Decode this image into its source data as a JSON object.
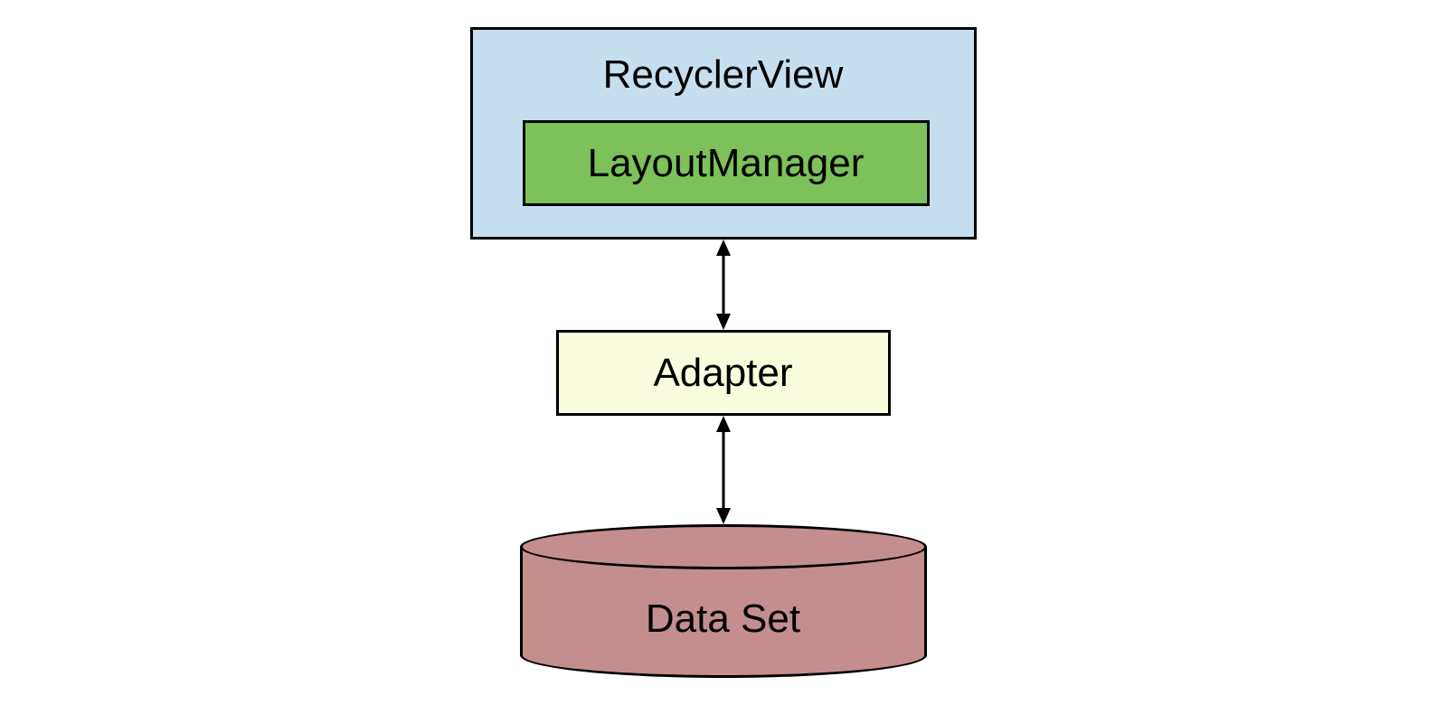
{
  "boxes": {
    "recyclerview": "RecyclerView",
    "layoutmanager": "LayoutManager",
    "adapter": "Adapter",
    "dataset": "Data Set"
  },
  "colors": {
    "recyclerview_bg": "#c6dff0",
    "layoutmanager_bg": "#7cc15a",
    "adapter_bg": "#fafcde",
    "dataset_bg": "#c48e8e",
    "border": "#000000"
  }
}
